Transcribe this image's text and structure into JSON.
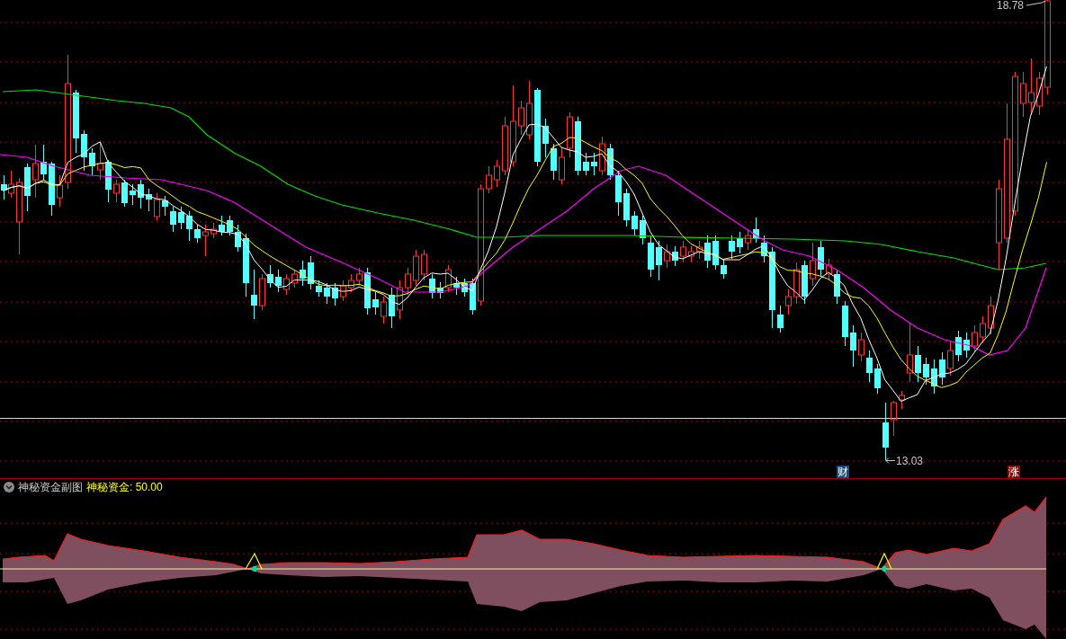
{
  "main_chart": {
    "high_label": "18.78",
    "low_label": "13.03",
    "markers": [
      {
        "text": "财",
        "color": "#184a7e"
      },
      {
        "text": "涨",
        "color": "#8a0c0c"
      }
    ]
  },
  "indicator_panel": {
    "title": "神秘资金副图",
    "reading": "神秘资金: 50.00"
  }
}
